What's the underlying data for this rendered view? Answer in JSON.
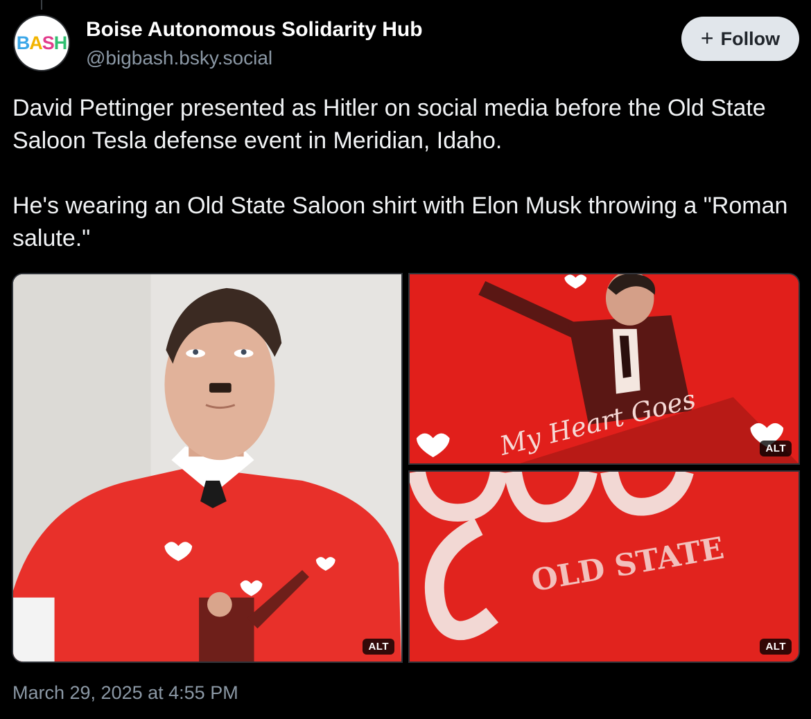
{
  "author": {
    "avatar_text": [
      "B",
      "A",
      "S",
      "H"
    ],
    "name": "Boise Autonomous Solidarity Hub",
    "handle": "@bigbash.bsky.social"
  },
  "follow": {
    "icon": "plus-icon",
    "label": "Follow"
  },
  "post": {
    "paragraphs": [
      "David Pettinger presented as Hitler on social media before the Old State Saloon Tesla defense event in Meridian, Idaho.",
      "He's wearing an Old State Saloon shirt with Elon Musk throwing a \"Roman salute.\""
    ]
  },
  "media": {
    "images": [
      {
        "alt_label": "ALT"
      },
      {
        "alt_label": "ALT",
        "shirt_text": "My Heart Goes"
      },
      {
        "alt_label": "ALT",
        "shirt_text": "OLD STATE"
      }
    ]
  },
  "timestamp": "March 29, 2025 at 4:55 PM",
  "colors": {
    "background": "#000000",
    "text": "#f1f3f5",
    "muted": "#8b98a5",
    "follow_bg": "#e1e6eb",
    "shirt_red": "#e0201c"
  }
}
